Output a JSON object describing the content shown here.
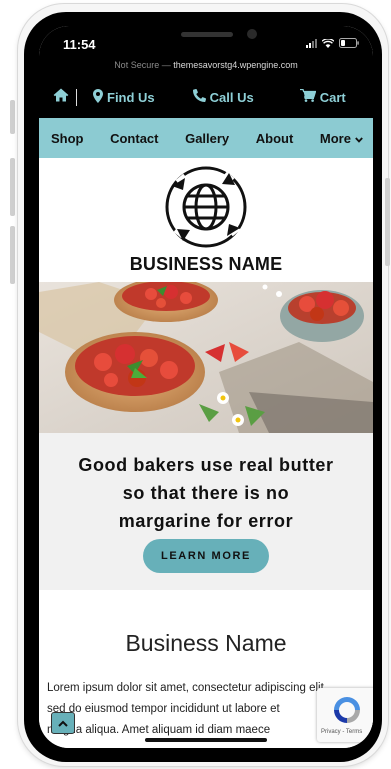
{
  "status_bar": {
    "time": "11:54"
  },
  "url_bar": {
    "insecure_label": "Not Secure —",
    "domain": "themesavorstg4.wpengine.com"
  },
  "action_bar": {
    "find_us": "Find Us",
    "call_us": "Call Us",
    "cart": "Cart"
  },
  "nav": {
    "items": [
      "Shop",
      "Contact",
      "Gallery",
      "About",
      "More"
    ]
  },
  "logo": {
    "business_name": "BUSINESS NAME"
  },
  "hero": {
    "tagline_line1": "Good bakers use real butter",
    "tagline_line2": "so that there is no",
    "tagline_line3": "margarine for error",
    "cta_label": "LEARN MORE"
  },
  "about": {
    "title": "Business Name",
    "body_line1": "Lorem ipsum dolor sit amet, consectetur adipiscing elit,",
    "body_line2": "sed do eiusmod tempor incididunt ut labore et",
    "body_line3": "magna aliqua. Amet aliquam id diam maece"
  },
  "recaptcha": {
    "terms": "Privacy - Terms"
  },
  "colors": {
    "accent": "#8ccbd2",
    "button": "#67b0b9",
    "action_text": "#8ecfd6"
  },
  "icons": [
    "home-icon",
    "map-marker-icon",
    "phone-icon",
    "cart-icon",
    "chevron-down-icon",
    "globe-icon",
    "chevron-up-icon",
    "recaptcha-icon"
  ]
}
